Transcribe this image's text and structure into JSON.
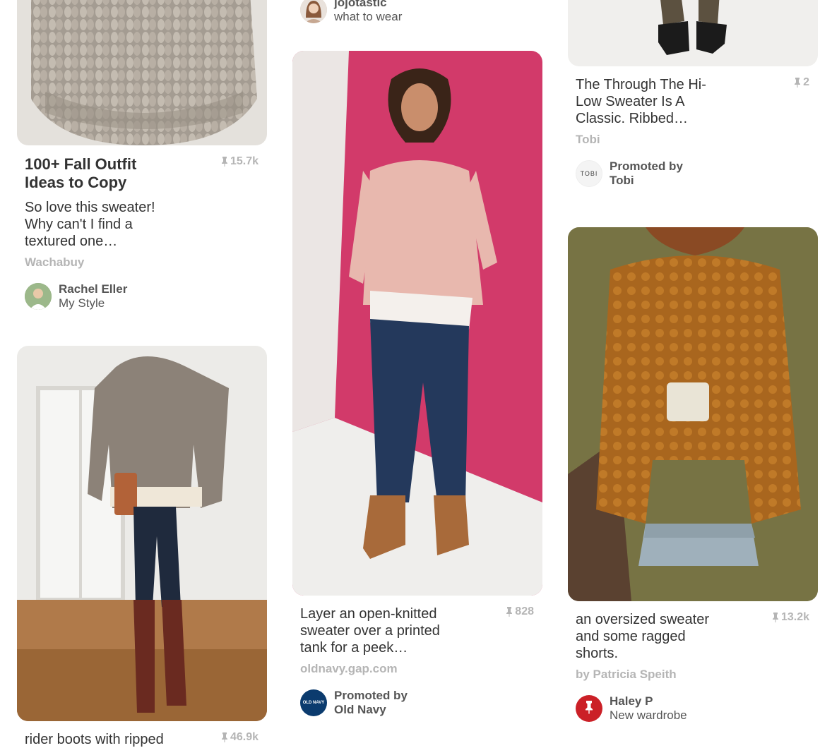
{
  "pins": [
    {
      "title": "100+ Fall Outfit Ideas to Copy",
      "description": "So love this sweater! Why can't I find a textured one…",
      "source": "Wachabuy",
      "saves": "15.7k",
      "user_name": "Rachel Eller",
      "board": "My Style"
    },
    {
      "user_name": "jojotastic",
      "board": "what to wear"
    },
    {
      "description": "Layer an open-knitted sweater over a printed tank for a peek…",
      "source": "oldnavy.gap.com",
      "saves": "828",
      "promoted_label": "Promoted by",
      "promoter": "Old Navy",
      "avatar_text": "OLD NAVY"
    },
    {
      "description": "The Through The Hi-Low Sweater Is A Classic. Ribbed…",
      "source": "Tobi",
      "saves": "2",
      "promoted_label": "Promoted by",
      "promoter": "Tobi",
      "avatar_text": "TOBI"
    },
    {
      "description": "an oversized sweater and some ragged shorts.",
      "source": "by Patricia Speith",
      "saves": "13.2k",
      "user_name": "Haley P",
      "board": "New wardrobe"
    },
    {
      "description": "rider boots with ripped",
      "saves": "46.9k"
    }
  ],
  "colors": {
    "muted_text": "#b5b5b5",
    "old_navy_blue": "#0b3b6e",
    "pinterest_red": "#cb2027"
  }
}
